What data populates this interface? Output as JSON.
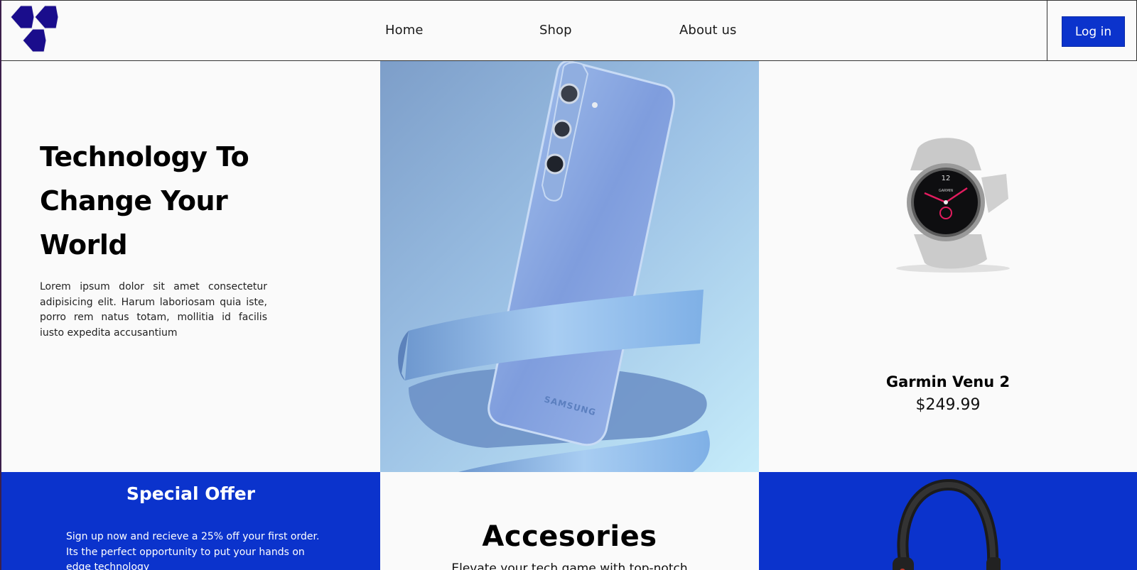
{
  "header": {
    "nav": {
      "home": "Home",
      "shop": "Shop",
      "about": "About us"
    },
    "login_label": "Log in",
    "brand_color": "#1a0d8c"
  },
  "hero": {
    "title_lines": [
      "Technology To",
      "Change Your",
      "World"
    ],
    "description": "Lorem ipsum dolor sit amet consectetur adipisicing elit. Harum laboriosam quia iste, porro rem natus totam, mollitia id facilis iusto expedita accusantium",
    "phone_brand": "SAMSUNG"
  },
  "featured_product": {
    "name": "Garmin Venu 2",
    "price": "$249.99",
    "watch_face_top": "12",
    "watch_brand": "GARMIN"
  },
  "special_offer": {
    "title": "Special Offer",
    "text": "Sign up now and recieve a 25% off your first order. Its the perfect opportunity to put your hands on edge technology"
  },
  "accessories": {
    "title": "Accesories",
    "text": "Elevate your tech game with top-notch"
  },
  "colors": {
    "accent": "#0b33cc",
    "background": "#fafafa",
    "logo": "#1a0d8c"
  }
}
